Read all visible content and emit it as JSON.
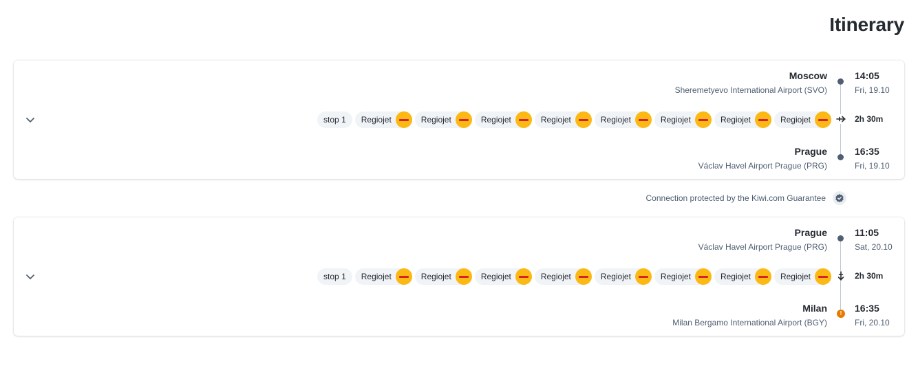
{
  "page": {
    "title": "Itinerary"
  },
  "segments": [
    {
      "origin": {
        "city": "Moscow",
        "airport": "Sheremetyevo International Airport (SVO)",
        "time": "14:05",
        "date": "Fri, 19.10"
      },
      "destination": {
        "city": "Prague",
        "airport": "Václav Havel Airport Prague (PRG)",
        "time": "16:35",
        "date": "Fri, 19.10"
      },
      "duration": "2h 30m",
      "stop_label": "stop 1",
      "carriers": [
        "Regiojet",
        "Regiojet",
        "Regiojet",
        "Regiojet",
        "Regiojet",
        "Regiojet",
        "Regiojet",
        "Regiojet"
      ],
      "destination_warning": false
    },
    {
      "origin": {
        "city": "Prague",
        "airport": "Václav Havel Airport Prague (PRG)",
        "time": "11:05",
        "date": "Sat, 20.10"
      },
      "destination": {
        "city": "Milan",
        "airport": "Milan Bergamo International Airport (BGY)",
        "time": "16:35",
        "date": "Fri, 20.10"
      },
      "duration": "2h 30m",
      "stop_label": "stop 1",
      "carriers": [
        "Regiojet",
        "Regiojet",
        "Regiojet",
        "Regiojet",
        "Regiojet",
        "Regiojet",
        "Regiojet",
        "Regiojet"
      ],
      "destination_warning": true
    }
  ],
  "guarantee": {
    "text": "Connection protected by the Kiwi.com Guarantee"
  },
  "colors": {
    "text": "#252a31",
    "secondary": "#4f5e71",
    "carrier_logo": "#fcb813",
    "warning": "#e77a00"
  },
  "icons": {
    "expand": "chevron-down-icon",
    "flight": "airplane-icon",
    "guarantee": "shield-check-icon"
  }
}
